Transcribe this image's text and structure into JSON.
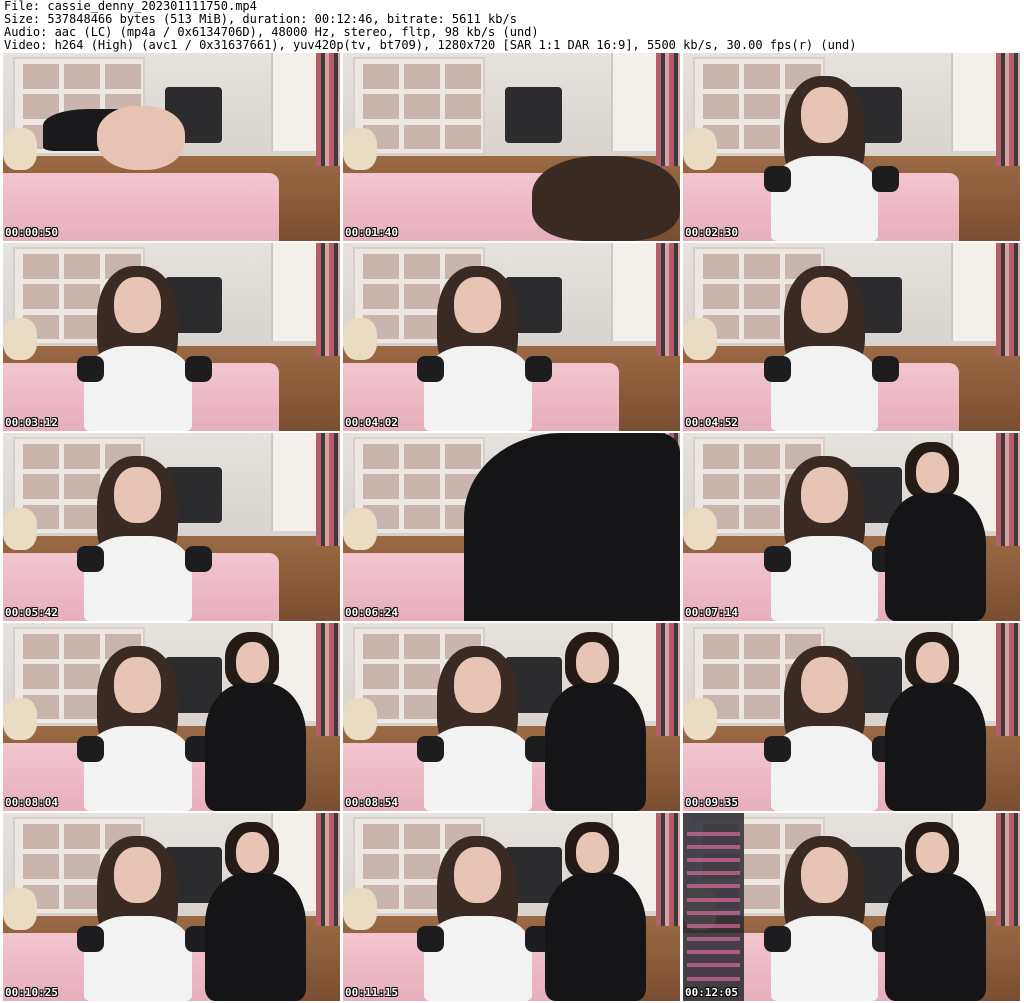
{
  "header": {
    "file": "File: cassie_denny_202301111750.mp4",
    "size": "Size: 537848466 bytes (513 MiB), duration: 00:12:46, bitrate: 5611 kb/s",
    "audio": "Audio: aac (LC) (mp4a / 0x6134706D), 48000 Hz, stereo, fltp, 98 kb/s (und)",
    "video": "Video: h264 (High) (avc1 / 0x31637661), yuv420p(tv, bt709), 1280x720 [SAR 1:1 DAR 16:9], 5500 kb/s, 30.00 fps(r) (und)"
  },
  "thumbnails": [
    {
      "timestamp": "00:00:50"
    },
    {
      "timestamp": "00:01:40"
    },
    {
      "timestamp": "00:02:30"
    },
    {
      "timestamp": "00:03:12"
    },
    {
      "timestamp": "00:04:02"
    },
    {
      "timestamp": "00:04:52"
    },
    {
      "timestamp": "00:05:42"
    },
    {
      "timestamp": "00:06:24"
    },
    {
      "timestamp": "00:07:14"
    },
    {
      "timestamp": "00:08:04"
    },
    {
      "timestamp": "00:08:54"
    },
    {
      "timestamp": "00:09:35"
    },
    {
      "timestamp": "00:10:25"
    },
    {
      "timestamp": "00:11:15"
    },
    {
      "timestamp": "00:12:05"
    }
  ],
  "colors": {
    "background": "#ffffff",
    "timestamp_text": "#ffffff",
    "bed": "#f2c6d0",
    "floor": "#8a5b3b"
  }
}
